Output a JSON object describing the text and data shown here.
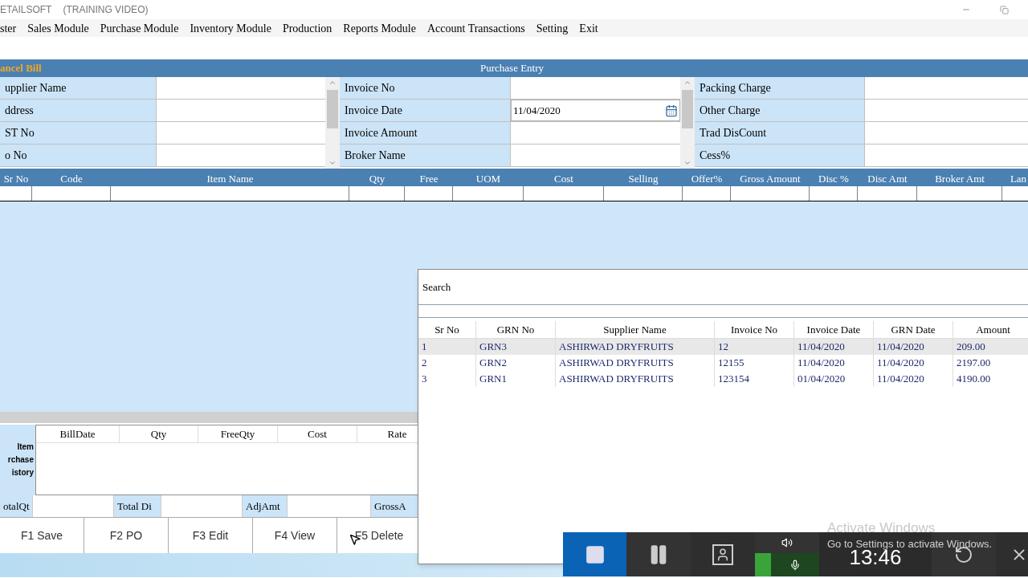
{
  "window": {
    "title": "ETAILSOFT",
    "subtitle": "(TRAINING VIDEO)"
  },
  "menu": [
    "ster",
    "Sales Module",
    "Purchase Module",
    "Inventory Module",
    "Production",
    "Reports Module",
    "Account Transactions",
    "Setting",
    "Exit"
  ],
  "header": {
    "left": "ancel Bill",
    "title": "Purchase Entry"
  },
  "form_groups": [
    {
      "fields": [
        {
          "label": "upplier Name",
          "kind": "text"
        },
        {
          "label": "ddress",
          "kind": "text"
        },
        {
          "label": "ST No",
          "kind": "text"
        },
        {
          "label": "o No",
          "kind": "text"
        }
      ]
    },
    {
      "fields": [
        {
          "label": "Invoice No",
          "kind": "text"
        },
        {
          "label": "Invoice Date",
          "kind": "date",
          "value": "11/04/2020"
        },
        {
          "label": "Invoice Amount",
          "kind": "text"
        },
        {
          "label": "Broker Name",
          "kind": "text"
        }
      ]
    },
    {
      "fields": [
        {
          "label": "Packing Charge",
          "kind": "text"
        },
        {
          "label": "Other Charge",
          "kind": "text"
        },
        {
          "label": "Trad DisCount",
          "kind": "text"
        },
        {
          "label": "Cess%",
          "kind": "text"
        }
      ]
    }
  ],
  "grid": {
    "columns": [
      "Sr No",
      "Code",
      "Item Name",
      "Qty",
      "Free",
      "UOM",
      "Cost",
      "Selling",
      "Offer%",
      "Gross Amount",
      "Disc %",
      "Disc Amt",
      "Broker Amt",
      "Lan"
    ]
  },
  "history": {
    "label_lines": [
      "Item",
      "rchase",
      "istory"
    ],
    "columns": [
      "BillDate",
      "Qty",
      "FreeQty",
      "Cost",
      "Rate"
    ]
  },
  "totals": [
    "otalQt",
    "Total Di",
    "AdjAmt",
    "GrossA"
  ],
  "buttons": [
    "F1 Save",
    "F2 PO",
    "F3 Edit",
    "F4 View",
    "F5 Delete"
  ],
  "search_dialog": {
    "title": "Search",
    "columns": [
      "Sr No",
      "GRN No",
      "Supplier Name",
      "Invoice No",
      "Invoice Date",
      "GRN Date",
      "Amount"
    ],
    "rows": [
      {
        "selected": true,
        "cells": [
          "1",
          "GRN3",
          "ASHIRWAD DRYFRUITS",
          "12",
          "11/04/2020",
          "11/04/2020",
          "209.00"
        ]
      },
      {
        "selected": false,
        "cells": [
          "2",
          "GRN2",
          "ASHIRWAD DRYFRUITS",
          "12155",
          "11/04/2020",
          "11/04/2020",
          "2197.00"
        ]
      },
      {
        "selected": false,
        "cells": [
          "3",
          "GRN1",
          "ASHIRWAD DRYFRUITS",
          "123154",
          "01/04/2020",
          "11/04/2020",
          "4190.00"
        ]
      }
    ]
  },
  "recorder": {
    "time": "13:46"
  },
  "activation": {
    "title": "Activate Windows",
    "text": "Go to Settings to activate Windows."
  }
}
